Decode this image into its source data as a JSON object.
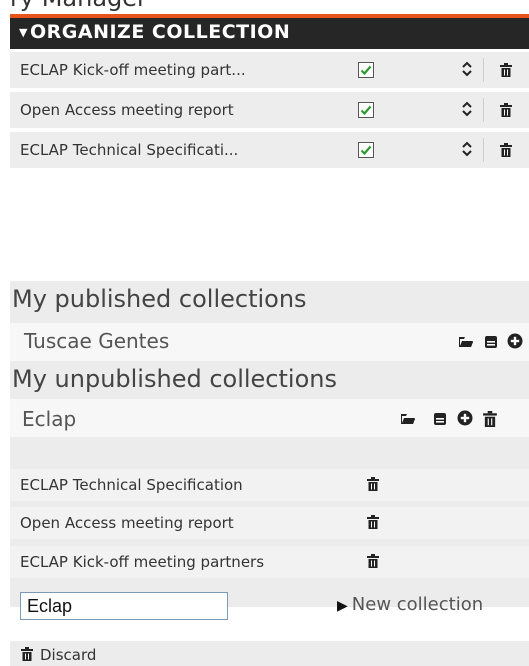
{
  "page_top_text": "ry Manager",
  "organize": {
    "title": "ORGANIZE COLLECTION",
    "items": [
      {
        "label": "ECLAP Kick-off meeting part...",
        "checked": true
      },
      {
        "label": "Open Access meeting report",
        "checked": true
      },
      {
        "label": "ECLAP Technical Specificati...",
        "checked": true
      }
    ]
  },
  "published": {
    "heading": "My published collections",
    "collections": [
      {
        "name": "Tuscae Gentes"
      }
    ]
  },
  "unpublished": {
    "heading": "My unpublished collections",
    "collection_name": "Eclap",
    "items": [
      {
        "label": "ECLAP Technical Specification"
      },
      {
        "label": "Open Access meeting report"
      },
      {
        "label": "ECLAP Kick-off meeting partners"
      }
    ]
  },
  "new_collection": {
    "input_value": "Eclap",
    "button_label": "New collection"
  },
  "discard": {
    "label": "Discard"
  },
  "colors": {
    "accent": "#e8541a",
    "header_bg": "#262626",
    "check": "#2d9a2d"
  },
  "icons": [
    "chevron-down-icon",
    "checkbox-icon",
    "sort-arrows-icon",
    "trash-icon",
    "folder-open-icon",
    "save-icon",
    "plus-circle-icon",
    "play-arrow-icon"
  ]
}
